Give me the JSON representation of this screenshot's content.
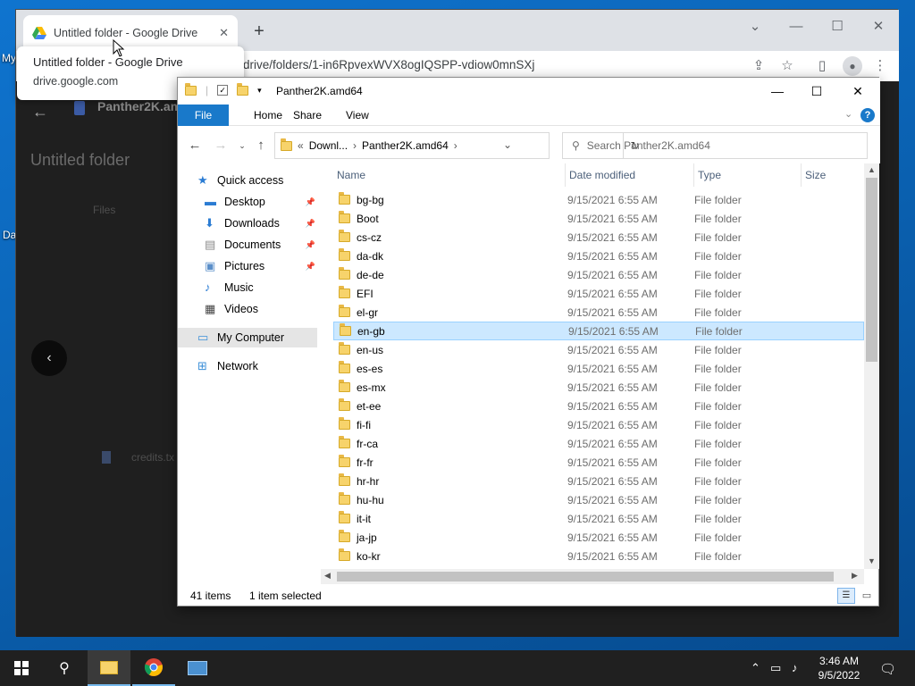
{
  "desktop": {
    "icon_labels": [
      "My",
      "Da"
    ]
  },
  "chrome": {
    "tab_title": "Untitled folder - Google Drive",
    "new_tab": "+",
    "url": "drive/folders/1-in6RpvexWVX8ogIQSPP-vdiow0mnSXj",
    "tooltip_title": "Untitled folder - Google Drive",
    "tooltip_domain": "drive.google.com",
    "page_header_text": "Panther2K.am",
    "page_title": "Untitled folder",
    "page_section": "Files",
    "page_file": "credits.tx"
  },
  "explorer": {
    "title": "Panther2K.amd64",
    "ribbon_tabs": [
      "File",
      "Home",
      "Share",
      "View"
    ],
    "address": {
      "prefix": "«",
      "part1": "Downl...",
      "part2": "Panther2K.amd64"
    },
    "search_placeholder": "Search Panther2K.amd64",
    "nav_items": [
      {
        "label": "Quick access",
        "icon": "star-icon",
        "pinned": false
      },
      {
        "label": "Desktop",
        "icon": "desktop-icon",
        "pinned": true
      },
      {
        "label": "Downloads",
        "icon": "download-icon",
        "pinned": true
      },
      {
        "label": "Documents",
        "icon": "documents-icon",
        "pinned": true
      },
      {
        "label": "Pictures",
        "icon": "pictures-icon",
        "pinned": true
      },
      {
        "label": "Music",
        "icon": "music-icon",
        "pinned": false
      },
      {
        "label": "Videos",
        "icon": "videos-icon",
        "pinned": false
      },
      {
        "label": "My Computer",
        "icon": "computer-icon",
        "pinned": false
      },
      {
        "label": "Network",
        "icon": "network-icon",
        "pinned": false
      }
    ],
    "columns": [
      "Name",
      "Date modified",
      "Type",
      "Size"
    ],
    "rows": [
      {
        "name": "bg-bg",
        "date": "9/15/2021 6:55 AM",
        "type": "File folder"
      },
      {
        "name": "Boot",
        "date": "9/15/2021 6:55 AM",
        "type": "File folder"
      },
      {
        "name": "cs-cz",
        "date": "9/15/2021 6:55 AM",
        "type": "File folder"
      },
      {
        "name": "da-dk",
        "date": "9/15/2021 6:55 AM",
        "type": "File folder"
      },
      {
        "name": "de-de",
        "date": "9/15/2021 6:55 AM",
        "type": "File folder"
      },
      {
        "name": "EFI",
        "date": "9/15/2021 6:55 AM",
        "type": "File folder"
      },
      {
        "name": "el-gr",
        "date": "9/15/2021 6:55 AM",
        "type": "File folder"
      },
      {
        "name": "en-gb",
        "date": "9/15/2021 6:55 AM",
        "type": "File folder",
        "selected": true
      },
      {
        "name": "en-us",
        "date": "9/15/2021 6:55 AM",
        "type": "File folder"
      },
      {
        "name": "es-es",
        "date": "9/15/2021 6:55 AM",
        "type": "File folder"
      },
      {
        "name": "es-mx",
        "date": "9/15/2021 6:55 AM",
        "type": "File folder"
      },
      {
        "name": "et-ee",
        "date": "9/15/2021 6:55 AM",
        "type": "File folder"
      },
      {
        "name": "fi-fi",
        "date": "9/15/2021 6:55 AM",
        "type": "File folder"
      },
      {
        "name": "fr-ca",
        "date": "9/15/2021 6:55 AM",
        "type": "File folder"
      },
      {
        "name": "fr-fr",
        "date": "9/15/2021 6:55 AM",
        "type": "File folder"
      },
      {
        "name": "hr-hr",
        "date": "9/15/2021 6:55 AM",
        "type": "File folder"
      },
      {
        "name": "hu-hu",
        "date": "9/15/2021 6:55 AM",
        "type": "File folder"
      },
      {
        "name": "it-it",
        "date": "9/15/2021 6:55 AM",
        "type": "File folder"
      },
      {
        "name": "ja-jp",
        "date": "9/15/2021 6:55 AM",
        "type": "File folder"
      },
      {
        "name": "ko-kr",
        "date": "9/15/2021 6:55 AM",
        "type": "File folder"
      }
    ],
    "status": {
      "items": "41 items",
      "selected": "1 item selected"
    }
  },
  "taskbar": {
    "time": "3:46 AM",
    "date": "9/5/2022"
  },
  "colors": {
    "selection": "#cce8ff",
    "file_tab": "#1979ca",
    "taskbar": "#202020"
  }
}
